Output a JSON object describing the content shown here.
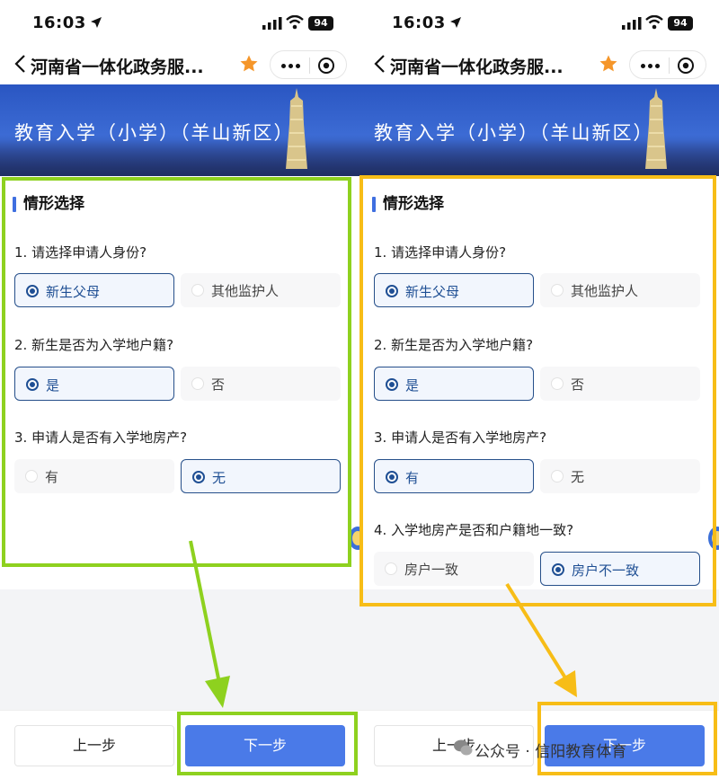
{
  "panels": [
    {
      "status": {
        "time": "16:03",
        "battery": "94"
      },
      "nav": {
        "title": "河南省一体化政务服..."
      },
      "banner": {
        "title": "教育入学（小学）（羊山新区）"
      },
      "section": {
        "title": "情形选择"
      },
      "questions": [
        {
          "text": "1. 请选择申请人身份?",
          "options": [
            {
              "label": "新生父母",
              "selected": true
            },
            {
              "label": "其他监护人",
              "selected": false
            }
          ]
        },
        {
          "text": "2. 新生是否为入学地户籍?",
          "options": [
            {
              "label": "是",
              "selected": true
            },
            {
              "label": "否",
              "selected": false
            }
          ]
        },
        {
          "text": "3. 申请人是否有入学地房产?",
          "options": [
            {
              "label": "有",
              "selected": false
            },
            {
              "label": "无",
              "selected": true
            }
          ]
        }
      ],
      "buttons": {
        "prev": "上一步",
        "next": "下一步"
      }
    },
    {
      "status": {
        "time": "16:03",
        "battery": "94"
      },
      "nav": {
        "title": "河南省一体化政务服..."
      },
      "banner": {
        "title": "教育入学（小学）（羊山新区）"
      },
      "section": {
        "title": "情形选择"
      },
      "questions": [
        {
          "text": "1. 请选择申请人身份?",
          "options": [
            {
              "label": "新生父母",
              "selected": true
            },
            {
              "label": "其他监护人",
              "selected": false
            }
          ]
        },
        {
          "text": "2. 新生是否为入学地户籍?",
          "options": [
            {
              "label": "是",
              "selected": true
            },
            {
              "label": "否",
              "selected": false
            }
          ]
        },
        {
          "text": "3. 申请人是否有入学地房产?",
          "options": [
            {
              "label": "有",
              "selected": true
            },
            {
              "label": "无",
              "selected": false
            }
          ]
        },
        {
          "text": "4. 入学地房产是否和户籍地一致?",
          "options": [
            {
              "label": "房户一致",
              "selected": false
            },
            {
              "label": "房户不一致",
              "selected": true
            }
          ]
        }
      ],
      "buttons": {
        "prev": "上一步",
        "next": "下一步"
      }
    }
  ],
  "watermark": "公众号 · 信阳教育体育",
  "colors": {
    "green_highlight": "#8ed11f",
    "yellow_highlight": "#f7bd17",
    "accent": "#4a7ae8",
    "selected": "#1f4f94"
  }
}
